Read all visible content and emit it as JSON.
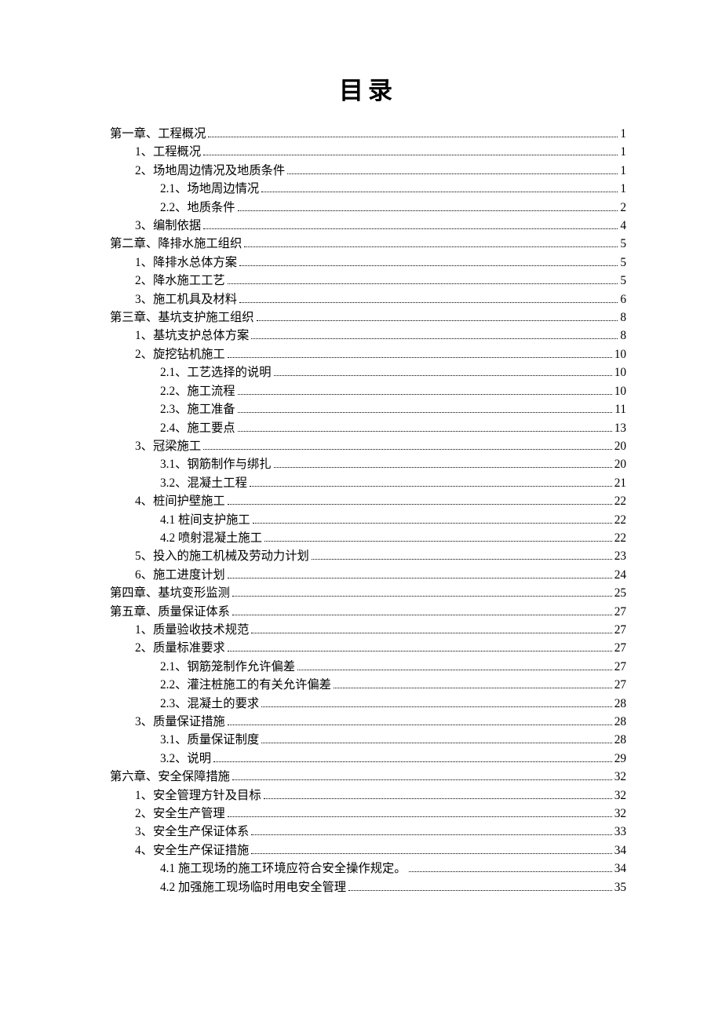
{
  "title": "目录",
  "toc": [
    {
      "level": 0,
      "label": "第一章、工程概况",
      "page": "1"
    },
    {
      "level": 1,
      "label": "1、工程概况",
      "page": "1"
    },
    {
      "level": 1,
      "label": "2、场地周边情况及地质条件",
      "page": "1"
    },
    {
      "level": 2,
      "label": "2.1、场地周边情况",
      "page": "1"
    },
    {
      "level": 2,
      "label": "2.2、地质条件",
      "page": "2"
    },
    {
      "level": 1,
      "label": "3、编制依据",
      "page": "4"
    },
    {
      "level": 0,
      "label": "第二章、降排水施工组织",
      "page": "5"
    },
    {
      "level": 1,
      "label": "1、降排水总体方案",
      "page": "5"
    },
    {
      "level": 1,
      "label": "2、降水施工工艺",
      "page": "5"
    },
    {
      "level": 1,
      "label": "3、施工机具及材料",
      "page": "6"
    },
    {
      "level": 0,
      "label": "第三章、基坑支护施工组织",
      "page": "8"
    },
    {
      "level": 1,
      "label": "1、基坑支护总体方案",
      "page": "8"
    },
    {
      "level": 1,
      "label": "2、旋挖钻机施工",
      "page": "10"
    },
    {
      "level": 2,
      "label": "2.1、工艺选择的说明",
      "page": "10"
    },
    {
      "level": 2,
      "label": "2.2、施工流程",
      "page": "10"
    },
    {
      "level": 2,
      "label": "2.3、施工准备",
      "page": "11"
    },
    {
      "level": 2,
      "label": "2.4、施工要点",
      "page": "13"
    },
    {
      "level": 1,
      "label": "3、冠梁施工",
      "page": "20"
    },
    {
      "level": 2,
      "label": "3.1、钢筋制作与绑扎",
      "page": "20"
    },
    {
      "level": 2,
      "label": "3.2、混凝土工程",
      "page": "21"
    },
    {
      "level": 1,
      "label": "4、桩间护壁施工",
      "page": "22"
    },
    {
      "level": 2,
      "label": "4.1 桩间支护施工",
      "page": "22"
    },
    {
      "level": 2,
      "label": "4.2 喷射混凝土施工",
      "page": "22"
    },
    {
      "level": 1,
      "label": "5、投入的施工机械及劳动力计划",
      "page": "23"
    },
    {
      "level": 1,
      "label": "6、施工进度计划",
      "page": "24"
    },
    {
      "level": 0,
      "label": "第四章、基坑变形监测",
      "page": "25"
    },
    {
      "level": 0,
      "label": "第五章、质量保证体系",
      "page": "27"
    },
    {
      "level": 1,
      "label": "1、质量验收技术规范",
      "page": "27"
    },
    {
      "level": 1,
      "label": "2、质量标准要求",
      "page": "27"
    },
    {
      "level": 2,
      "label": "2.1、钢筋笼制作允许偏差",
      "page": "27"
    },
    {
      "level": 2,
      "label": "2.2、灌注桩施工的有关允许偏差",
      "page": "27"
    },
    {
      "level": 2,
      "label": "2.3、混凝土的要求",
      "page": "28"
    },
    {
      "level": 1,
      "label": "3、质量保证措施",
      "page": "28"
    },
    {
      "level": 2,
      "label": "3.1、质量保证制度",
      "page": "28"
    },
    {
      "level": 2,
      "label": "3.2、说明",
      "page": "29"
    },
    {
      "level": 0,
      "label": "第六章、安全保障措施",
      "page": "32"
    },
    {
      "level": 1,
      "label": "1、安全管理方针及目标",
      "page": "32"
    },
    {
      "level": 1,
      "label": "2、安全生产管理",
      "page": "32"
    },
    {
      "level": 1,
      "label": "3、安全生产保证体系",
      "page": "33"
    },
    {
      "level": 1,
      "label": "4、安全生产保证措施",
      "page": "34"
    },
    {
      "level": 2,
      "label": "4.1 施工现场的施工环境应符合安全操作规定。",
      "page": "34"
    },
    {
      "level": 2,
      "label": "4.2 加强施工现场临时用电安全管理",
      "page": "35"
    }
  ]
}
